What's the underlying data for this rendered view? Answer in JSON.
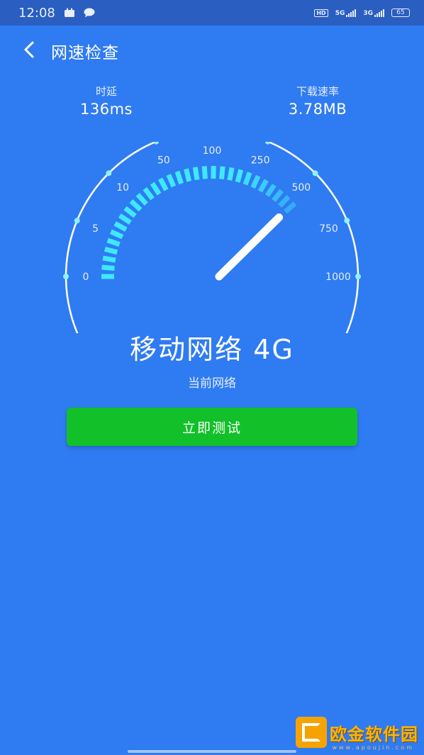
{
  "status_bar": {
    "time": "12:08",
    "hd_label": "HD",
    "network_1": "5G",
    "network_2": "3G",
    "battery": "65"
  },
  "header": {
    "title": "网速检查"
  },
  "metrics": {
    "latency": {
      "label": "时延",
      "value": "136ms"
    },
    "download": {
      "label": "下载速率",
      "value": "3.78MB"
    }
  },
  "gauge": {
    "ticks": [
      "0",
      "5",
      "10",
      "50",
      "100",
      "250",
      "500",
      "750",
      "1000"
    ],
    "needle_fraction": 0.77,
    "progress_fraction": 0.77
  },
  "network": {
    "name": "移动网络 4G",
    "subtitle": "当前网络"
  },
  "actions": {
    "test_label": "立即测试"
  },
  "watermark": {
    "text": "欧金软件园",
    "url": "www.apoujin.com"
  },
  "colors": {
    "background": "#2f7bf2",
    "status_bar": "#2a5ec0",
    "gauge_arc": "#3ee8ff",
    "button": "#12c02a"
  }
}
